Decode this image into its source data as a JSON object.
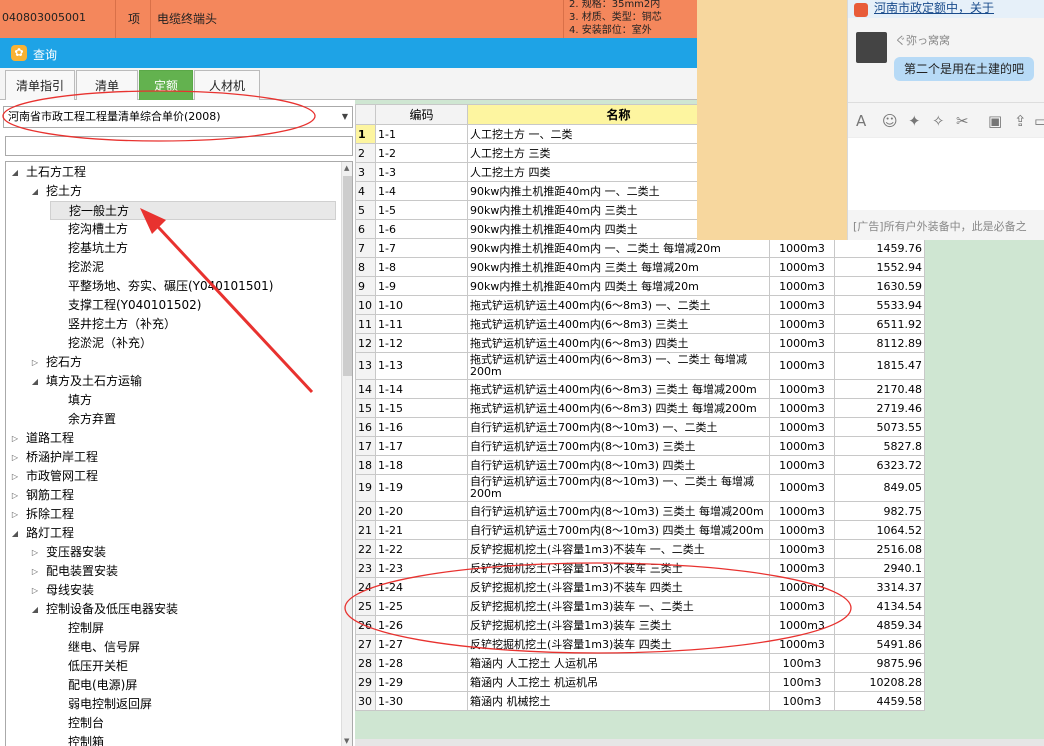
{
  "top_row": {
    "code": "040803005001",
    "unit": "项",
    "name": "电缆终端头",
    "spec_lines": [
      "2. 规格：35mm2内",
      "3. 材质、类型：铜芯",
      "4. 安装部位：室外"
    ]
  },
  "dialog": {
    "title": "查询",
    "tabs": [
      "清单指引",
      "清单",
      "定额",
      "人材机"
    ],
    "active_tab": "定额",
    "quota_set": "河南省市政工程工程量清单综合单价(2008)",
    "search_value": ""
  },
  "tree": [
    {
      "label": "土石方工程",
      "level": 0,
      "toggle": "expanded"
    },
    {
      "label": "挖土方",
      "level": 1,
      "toggle": "expanded"
    },
    {
      "label": "挖一般土方",
      "level": 2,
      "toggle": "none",
      "selected": true
    },
    {
      "label": "挖沟槽土方",
      "level": 2,
      "toggle": "none"
    },
    {
      "label": "挖基坑土方",
      "level": 2,
      "toggle": "none"
    },
    {
      "label": "挖淤泥",
      "level": 2,
      "toggle": "none"
    },
    {
      "label": "平整场地、夯实、碾压(Y040101501)",
      "level": 2,
      "toggle": "none"
    },
    {
      "label": "支撑工程(Y040101502)",
      "level": 2,
      "toggle": "none"
    },
    {
      "label": "竖井挖土方（补充）",
      "level": 2,
      "toggle": "none"
    },
    {
      "label": "挖淤泥（补充）",
      "level": 2,
      "toggle": "none"
    },
    {
      "label": "挖石方",
      "level": 1,
      "toggle": "collapsed"
    },
    {
      "label": "填方及土石方运输",
      "level": 1,
      "toggle": "expanded"
    },
    {
      "label": "填方",
      "level": 2,
      "toggle": "none"
    },
    {
      "label": "余方弃置",
      "level": 2,
      "toggle": "none"
    },
    {
      "label": "道路工程",
      "level": 0,
      "toggle": "collapsed"
    },
    {
      "label": "桥涵护岸工程",
      "level": 0,
      "toggle": "collapsed"
    },
    {
      "label": "市政管网工程",
      "level": 0,
      "toggle": "collapsed"
    },
    {
      "label": "钢筋工程",
      "level": 0,
      "toggle": "collapsed"
    },
    {
      "label": "拆除工程",
      "level": 0,
      "toggle": "collapsed"
    },
    {
      "label": "路灯工程",
      "level": 0,
      "toggle": "expanded"
    },
    {
      "label": "变压器安装",
      "level": 1,
      "toggle": "collapsed"
    },
    {
      "label": "配电装置安装",
      "level": 1,
      "toggle": "collapsed"
    },
    {
      "label": "母线安装",
      "level": 1,
      "toggle": "collapsed"
    },
    {
      "label": "控制设备及低压电器安装",
      "level": 1,
      "toggle": "expanded"
    },
    {
      "label": "控制屏",
      "level": 2,
      "toggle": "none"
    },
    {
      "label": "继电、信号屏",
      "level": 2,
      "toggle": "none"
    },
    {
      "label": "低压开关柜",
      "level": 2,
      "toggle": "none"
    },
    {
      "label": "配电(电源)屏",
      "level": 2,
      "toggle": "none"
    },
    {
      "label": "弱电控制返回屏",
      "level": 2,
      "toggle": "none"
    },
    {
      "label": "控制台",
      "level": 2,
      "toggle": "none"
    },
    {
      "label": "控制箱",
      "level": 2,
      "toggle": "none"
    }
  ],
  "grid": {
    "headers": {
      "code": "编码",
      "name": "名称"
    },
    "rows": [
      {
        "n": "1",
        "code": "1-1",
        "name": "人工挖土方 一、二类",
        "unit": "",
        "price": ""
      },
      {
        "n": "2",
        "code": "1-2",
        "name": "人工挖土方 三类",
        "unit": "",
        "price": ""
      },
      {
        "n": "3",
        "code": "1-3",
        "name": "人工挖土方 四类",
        "unit": "",
        "price": ""
      },
      {
        "n": "4",
        "code": "1-4",
        "name": "90kw内推土机推距40m内 一、二类土",
        "unit": "",
        "price": ""
      },
      {
        "n": "5",
        "code": "1-5",
        "name": "90kw内推土机推距40m内 三类土",
        "unit": "",
        "price": ""
      },
      {
        "n": "6",
        "code": "1-6",
        "name": "90kw内推土机推距40m内 四类土",
        "unit": "",
        "price": ""
      },
      {
        "n": "7",
        "code": "1-7",
        "name": "90kw内推土机推距40m内 一、二类土 每增减20m",
        "unit": "1000m3",
        "price": "1459.76"
      },
      {
        "n": "8",
        "code": "1-8",
        "name": "90kw内推土机推距40m内 三类土 每增减20m",
        "unit": "1000m3",
        "price": "1552.94"
      },
      {
        "n": "9",
        "code": "1-9",
        "name": "90kw内推土机推距40m内 四类土 每增减20m",
        "unit": "1000m3",
        "price": "1630.59"
      },
      {
        "n": "10",
        "code": "1-10",
        "name": "拖式铲运机铲运土400m内(6～8m3) 一、二类土",
        "unit": "1000m3",
        "price": "5533.94"
      },
      {
        "n": "11",
        "code": "1-11",
        "name": "拖式铲运机铲运土400m内(6～8m3) 三类土",
        "unit": "1000m3",
        "price": "6511.92"
      },
      {
        "n": "12",
        "code": "1-12",
        "name": "拖式铲运机铲运土400m内(6～8m3) 四类土",
        "unit": "1000m3",
        "price": "8112.89"
      },
      {
        "n": "13",
        "code": "1-13",
        "name": "拖式铲运机铲运土400m内(6～8m3) 一、二类土 每增减200m",
        "unit": "1000m3",
        "price": "1815.47",
        "tall": true
      },
      {
        "n": "14",
        "code": "1-14",
        "name": "拖式铲运机铲运土400m内(6～8m3) 三类土 每增减200m",
        "unit": "1000m3",
        "price": "2170.48"
      },
      {
        "n": "15",
        "code": "1-15",
        "name": "拖式铲运机铲运土400m内(6～8m3) 四类土 每增减200m",
        "unit": "1000m3",
        "price": "2719.46"
      },
      {
        "n": "16",
        "code": "1-16",
        "name": "自行铲运机铲运土700m内(8～10m3) 一、二类土",
        "unit": "1000m3",
        "price": "5073.55"
      },
      {
        "n": "17",
        "code": "1-17",
        "name": "自行铲运机铲运土700m内(8～10m3) 三类土",
        "unit": "1000m3",
        "price": "5827.8"
      },
      {
        "n": "18",
        "code": "1-18",
        "name": "自行铲运机铲运土700m内(8～10m3) 四类土",
        "unit": "1000m3",
        "price": "6323.72"
      },
      {
        "n": "19",
        "code": "1-19",
        "name": "自行铲运机铲运土700m内(8～10m3) 一、二类土 每增减200m",
        "unit": "1000m3",
        "price": "849.05",
        "tall": true
      },
      {
        "n": "20",
        "code": "1-20",
        "name": "自行铲运机铲运土700m内(8～10m3) 三类土 每增减200m",
        "unit": "1000m3",
        "price": "982.75"
      },
      {
        "n": "21",
        "code": "1-21",
        "name": "自行铲运机铲运土700m内(8～10m3) 四类土 每增减200m",
        "unit": "1000m3",
        "price": "1064.52"
      },
      {
        "n": "22",
        "code": "1-22",
        "name": "反铲挖掘机挖土(斗容量1m3)不装车 一、二类土",
        "unit": "1000m3",
        "price": "2516.08"
      },
      {
        "n": "23",
        "code": "1-23",
        "name": "反铲挖掘机挖土(斗容量1m3)不装车 三类土",
        "unit": "1000m3",
        "price": "2940.1"
      },
      {
        "n": "24",
        "code": "1-24",
        "name": "反铲挖掘机挖土(斗容量1m3)不装车 四类土",
        "unit": "1000m3",
        "price": "3314.37"
      },
      {
        "n": "25",
        "code": "1-25",
        "name": "反铲挖掘机挖土(斗容量1m3)装车 一、二类土",
        "unit": "1000m3",
        "price": "4134.54"
      },
      {
        "n": "26",
        "code": "1-26",
        "name": "反铲挖掘机挖土(斗容量1m3)装车 三类土",
        "unit": "1000m3",
        "price": "4859.34"
      },
      {
        "n": "27",
        "code": "1-27",
        "name": "反铲挖掘机挖土(斗容量1m3)装车 四类土",
        "unit": "1000m3",
        "price": "5491.86"
      },
      {
        "n": "28",
        "code": "1-28",
        "name": "箱涵内 人工挖土 人运机吊",
        "unit": "100m3",
        "price": "9875.96"
      },
      {
        "n": "29",
        "code": "1-29",
        "name": "箱涵内 人工挖土 机运机吊",
        "unit": "100m3",
        "price": "10208.28"
      },
      {
        "n": "30",
        "code": "1-30",
        "name": "箱涵内 机械挖土",
        "unit": "100m3",
        "price": "4459.58"
      }
    ]
  },
  "chat": {
    "notice": "河南市政定额中，关于",
    "sender": "ぐ弥っ窝窝",
    "message": "第二个是用在土建的吧",
    "ad": "[广告]所有户外装备中，此是必备之"
  },
  "colors": {
    "title_bar": "#1ea3e6",
    "active_tab": "#63b24f",
    "top_row": "#f4875c",
    "annotation": "#e8322f"
  }
}
